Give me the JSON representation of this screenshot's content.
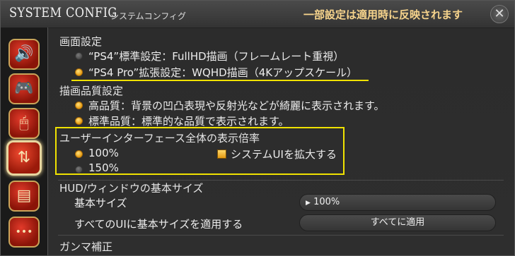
{
  "titlebar": {
    "title": "SYSTEM CONFIG",
    "subtitle": "システムコンフィグ",
    "notice": "一部設定は適用時に反映されます",
    "close_icon": "✕"
  },
  "sidebar": {
    "items": [
      {
        "icon": "speaker-icon",
        "glyph": "🔊"
      },
      {
        "icon": "gamepad-icon",
        "glyph": "🎮"
      },
      {
        "icon": "mouse-icon",
        "glyph": "🖱"
      },
      {
        "icon": "monitor-icon",
        "glyph": "⇅"
      },
      {
        "icon": "document-icon",
        "glyph": "▤"
      },
      {
        "icon": "more-icon",
        "glyph": "•••"
      }
    ]
  },
  "screen_settings": {
    "heading": "画面設定",
    "options": [
      "“PS4”標準設定：FullHD描画（フレームレート重視）",
      "“PS4 Pro”拡張設定：WQHD描画（4Kアップスケール）"
    ],
    "selected": 1
  },
  "quality": {
    "heading": "描画品質設定",
    "items": [
      "高品質：背景の凹凸表現や反射光などが綺麗に表示されます。",
      "標準品質：標準的な品質で表示されます。"
    ]
  },
  "ui_scale": {
    "heading": "ユーザーインターフェース全体の表示倍率",
    "options": [
      "100%",
      "150%"
    ],
    "selected": 0,
    "checkbox_label": "システムUIを拡大する",
    "checkbox_checked": true
  },
  "hud": {
    "heading": "HUD/ウィンドウの基本サイズ",
    "base_size_label": "基本サイズ",
    "base_size_value": "100%",
    "base_size_prefix": "▶",
    "apply_all_label": "すべてのUIに基本サイズを適用する",
    "apply_all_button": "すべてに適用"
  },
  "gamma": {
    "heading": "ガンマ補正"
  },
  "colors": {
    "highlight": "#f0e200",
    "accent": "#e69b12",
    "notice": "#f7d48c"
  }
}
